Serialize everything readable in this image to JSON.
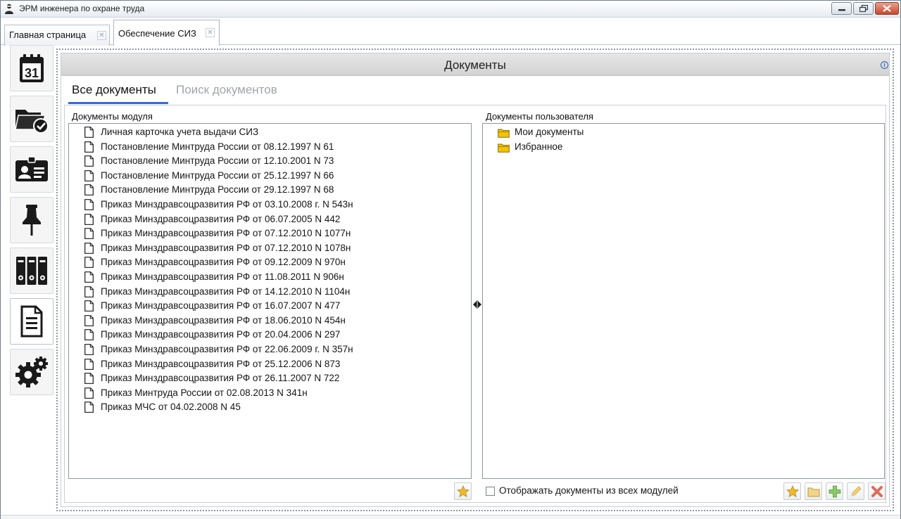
{
  "window": {
    "title": "ЭРМ инженера по охране труда"
  },
  "doc_tabs": [
    {
      "label": "Главная страница",
      "active": false
    },
    {
      "label": "Обеспечение СИЗ",
      "active": true
    }
  ],
  "sidebar": {
    "items": [
      {
        "name": "calendar-icon",
        "active": false
      },
      {
        "name": "folder-check-icon",
        "active": false
      },
      {
        "name": "id-card-icon",
        "active": false
      },
      {
        "name": "pushpin-icon",
        "active": false
      },
      {
        "name": "binders-icon",
        "active": false
      },
      {
        "name": "document-icon",
        "active": true
      },
      {
        "name": "gears-icon",
        "active": false
      }
    ]
  },
  "header": {
    "title": "Документы"
  },
  "sub_tabs": {
    "all": "Все документы",
    "search": "Поиск документов",
    "active": "all"
  },
  "left_pane": {
    "label": "Документы модуля",
    "documents": [
      "Личная карточка учета выдачи СИЗ",
      "Постановление Минтруда России от 08.12.1997 N 61",
      "Постановление Минтруда России от 12.10.2001 N 73",
      "Постановление Минтруда России от 25.12.1997 N 66",
      "Постановление Минтруда России от 29.12.1997 N 68",
      "Приказ Минздравсоцразвития РФ от 03.10.2008 г. N 543н",
      "Приказ Минздравсоцразвития РФ от 06.07.2005 N 442",
      "Приказ Минздравсоцразвития РФ от 07.12.2010 N 1077н",
      "Приказ Минздравсоцразвития РФ от 07.12.2010 N 1078н",
      "Приказ Минздравсоцразвития РФ от 09.12.2009 N 970н",
      "Приказ Минздравсоцразвития РФ от 11.08.2011 N 906н",
      "Приказ Минздравсоцразвития РФ от 14.12.2010 N 1104н",
      "Приказ Минздравсоцразвития РФ от 16.07.2007 N 477",
      "Приказ Минздравсоцразвития РФ от 18.06.2010 N 454н",
      "Приказ Минздравсоцразвития РФ от 20.04.2006 N 297",
      "Приказ Минздравсоцразвития РФ от 22.06.2009 г. N 357н",
      "Приказ Минздравсоцразвития РФ от 25.12.2006 N 873",
      "Приказ Минздравсоцразвития РФ от 26.11.2007 N 722",
      "Приказ Минтруда России от 02.08.2013 N 341н",
      "Приказ МЧС от 04.02.2008 N 45"
    ]
  },
  "right_pane": {
    "label": "Документы пользователя",
    "folders": [
      "Мои документы",
      "Избранное"
    ],
    "show_all_modules_label": "Отображать документы из всех модулей",
    "show_all_modules_checked": false
  },
  "buttons": {
    "left_favorite": "star-icon",
    "right": [
      "star-icon",
      "folder-icon",
      "plus-icon",
      "pencil-icon",
      "delete-icon"
    ]
  },
  "colors": {
    "accent": "#2f6fd0",
    "folder": "#f2c400",
    "star": "#f0b92b",
    "plus": "#6ab04c",
    "delete": "#e06a5a"
  }
}
